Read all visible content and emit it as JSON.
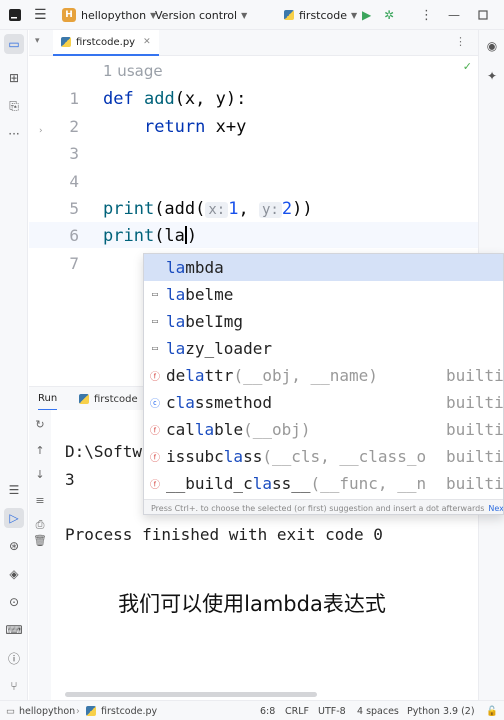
{
  "titlebar": {
    "project_badge": "H",
    "project_name": "hellopython",
    "vcs": "Version control",
    "run_config": "firstcode"
  },
  "editor": {
    "tab_label": "firstcode.py",
    "usage_hint": "1 usage",
    "line_numbers": [
      "1",
      "2",
      "3",
      "4",
      "5",
      "6",
      "7"
    ],
    "lines": {
      "l1_kw": "def",
      "l1_fn": "add",
      "l1_rest": "(x, y):",
      "l2_kw": "return",
      "l2_rest": " x+y",
      "l5_fn": "print",
      "l5_a": "(add(",
      "l5_hint_x": "x:",
      "l5_v1": "1",
      "l5_b": ", ",
      "l5_hint_y": "y:",
      "l5_v2": "2",
      "l5_c": "))",
      "l6_fn": "print",
      "l6_a": "(la",
      "l6_b": ")"
    }
  },
  "completion": {
    "items": [
      {
        "match": "la",
        "rest": "mbda",
        "sig": "",
        "module": "",
        "icon": "none"
      },
      {
        "match": "la",
        "rest": "belme",
        "sig": "",
        "module": "",
        "icon": "folder"
      },
      {
        "match": "la",
        "rest": "belImg",
        "sig": "",
        "module": "",
        "icon": "folder"
      },
      {
        "match": "la",
        "rest": "zy_loader",
        "sig": "",
        "module": "",
        "icon": "folder"
      },
      {
        "pre": "de",
        "match": "la",
        "rest": "ttr",
        "sig": "(__obj, __name)",
        "module": "builti",
        "icon": "function"
      },
      {
        "pre": "c",
        "match": "la",
        "rest": "ssmethod",
        "sig": "",
        "module": "builti",
        "icon": "class"
      },
      {
        "pre": "cal",
        "match": "la",
        "rest": "ble",
        "sig": "(__obj)",
        "module": "builti",
        "icon": "function"
      },
      {
        "pre": "issubc",
        "match": "la",
        "rest": "ss",
        "sig": "(__cls, __class_o",
        "module": "builti",
        "icon": "function"
      },
      {
        "pre": "__build_c",
        "match": "la",
        "rest": "ss__",
        "sig": "(__func, __n",
        "module": "builti",
        "icon": "function"
      }
    ],
    "hint_text": "Press Ctrl+. to choose the selected (or first) suggestion and insert a dot afterwards",
    "next_tip": "Next Tip"
  },
  "run": {
    "label": "Run",
    "tab": "firstcode",
    "output": [
      "D:\\Softw",
      "3",
      "",
      "Process finished with exit code 0"
    ],
    "caption": "我们可以使用lambda表达式"
  },
  "statusbar": {
    "project": "hellopython",
    "file": "firstcode.py",
    "position": "6:8",
    "line_sep": "CRLF",
    "encoding": "UTF-8",
    "indent": "4 spaces",
    "interpreter": "Python 3.9 (2)"
  },
  "colors": {
    "accent": "#3574f0",
    "keyword": "#0033b3",
    "function": "#00627a",
    "number": "#1750eb",
    "selection": "#d5e1f7"
  }
}
